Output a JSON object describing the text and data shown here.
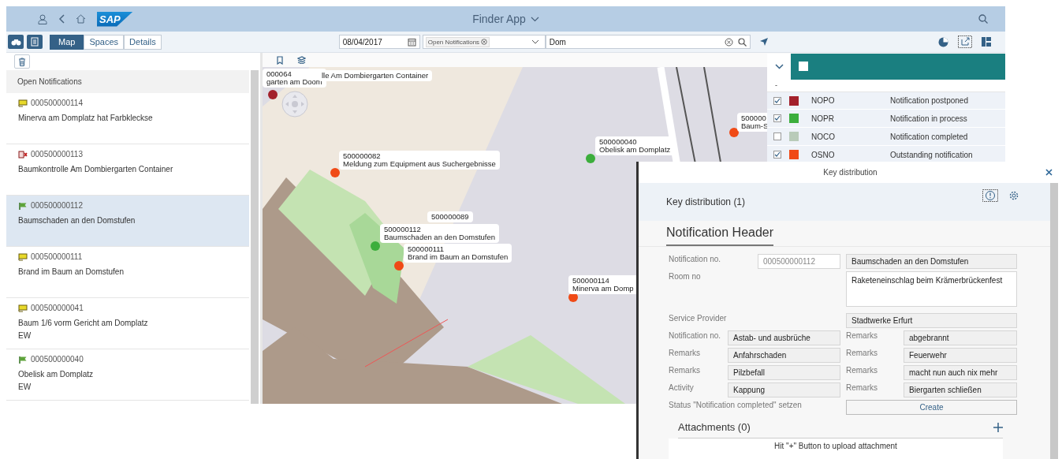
{
  "shell": {
    "logo": "SAP",
    "title": "Finder App"
  },
  "toolbar": {
    "views": [
      {
        "label": "Map",
        "selected": true
      },
      {
        "label": "Spaces",
        "selected": false
      },
      {
        "label": "Details",
        "selected": false
      }
    ],
    "date": "08/04/2017",
    "filter_token": "Open Notifications",
    "search": "Dom"
  },
  "list": {
    "title": "Open Notifications",
    "items": [
      {
        "kind": "open",
        "id": "000500000114",
        "text": "Minerva am Domplatz hat Farbkleckse",
        "selected": false
      },
      {
        "kind": "postponed",
        "id": "000500000113",
        "text": "Baumkontrolle Am Dombiergarten Container",
        "selected": false
      },
      {
        "kind": "in_process",
        "id": "000500000112",
        "text": "Baumschaden an den Domstufen",
        "selected": true
      },
      {
        "kind": "open",
        "id": "000500000111",
        "text": "Brand im Baum an Domstufen",
        "selected": false
      },
      {
        "kind": "open",
        "id": "000500000041",
        "text": "Baum 1/6 vorm Gericht am Domplatz",
        "sub": "EW",
        "selected": false
      },
      {
        "kind": "in_process",
        "id": "000500000040",
        "text": "Obelisk am Domplatz",
        "sub": "EW",
        "selected": false
      }
    ]
  },
  "map": {
    "markers": [
      {
        "color": "#a3212b"
      },
      {
        "color": "#f04a16"
      },
      {
        "color": "#3cae3c"
      },
      {
        "color": "#3cae3c"
      },
      {
        "color": "#f04a16"
      },
      {
        "color": "#f04a16"
      },
      {
        "color": "#f04a16"
      }
    ],
    "callouts": [
      {
        "lines": [
          "000064",
          "garten am Doom"
        ]
      },
      {
        "lines": [
          "lle Am Dombiergarten Container"
        ]
      },
      {
        "lines": [
          "500000082",
          "Meldung zum Equipment aus Suchergebnisse"
        ]
      },
      {
        "lines": [
          "500000040",
          "Obelisk am Domplatz"
        ]
      },
      {
        "lines": [
          "500000089"
        ]
      },
      {
        "lines": [
          "500000112",
          "Baumschaden an den Domstufen"
        ]
      },
      {
        "lines": [
          "500000111",
          "Brand im Baum an Domstufen"
        ]
      },
      {
        "lines": [
          "500000114",
          "Minerva am Domp"
        ]
      },
      {
        "lines": [
          "500000",
          "Baum-S"
        ]
      }
    ]
  },
  "legend": {
    "all_checked": false,
    "group": "-",
    "rows": [
      {
        "code": "NOPO",
        "label": "Notification postponed",
        "color": "#a3212b",
        "checked": true
      },
      {
        "code": "NOPR",
        "label": "Notification in process",
        "color": "#3cae3c",
        "checked": true
      },
      {
        "code": "NOCO",
        "label": "Notification completed",
        "color": "#b9cbb9",
        "checked": false
      },
      {
        "code": "OSNO",
        "label": "Outstanding notification",
        "color": "#f04a16",
        "checked": true
      }
    ]
  },
  "dialog": {
    "title": "Key distribution",
    "heading": "Key distribution (1)",
    "tab": "Notification Header",
    "form": [
      {
        "kind": "split",
        "label": "Notification no.",
        "fields": [
          {
            "value": "000500000112",
            "disabled": true
          },
          {
            "value": "Baumschaden an den Domstufen",
            "disabled": false
          }
        ]
      },
      {
        "kind": "textarea",
        "label": "Room no",
        "value": "Raketeneinschlag beim Krämerbrückenfest"
      },
      {
        "kind": "single",
        "label": "Service Provider",
        "value": "Stadtwerke Erfurt"
      },
      {
        "kind": "pair",
        "items": [
          {
            "label": "Notification no.",
            "value": "Astab- und ausbrüche"
          },
          {
            "label": "Remarks",
            "value": "abgebrannt"
          }
        ]
      },
      {
        "kind": "pair",
        "items": [
          {
            "label": "Remarks",
            "value": "Anfahrschaden"
          },
          {
            "label": "Remarks",
            "value": "Feuerwehr"
          }
        ]
      },
      {
        "kind": "pair",
        "items": [
          {
            "label": "Remarks",
            "value": "Pilzbefall"
          },
          {
            "label": "Remarks",
            "value": "macht nun auch nix mehr"
          }
        ]
      },
      {
        "kind": "pair",
        "items": [
          {
            "label": "Activity",
            "value": "Kappung"
          },
          {
            "label": "Remarks",
            "value": "Biergarten schließen"
          }
        ]
      },
      {
        "kind": "action",
        "label": "Status \"Notification completed\" setzen",
        "button": "Create"
      }
    ],
    "attachments": {
      "title": "Attachments (0)",
      "hint": "Hit \"+\" Button to upload attachment"
    }
  }
}
